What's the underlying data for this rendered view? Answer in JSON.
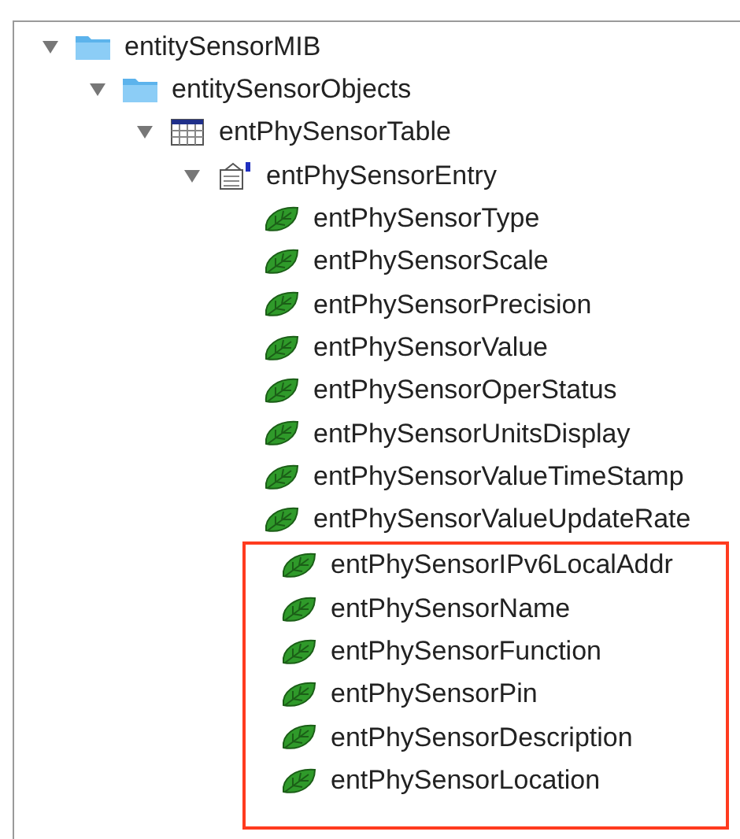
{
  "tree": [
    {
      "label": "entitySensorMIB",
      "kind": "folder",
      "expanded": true,
      "children": [
        {
          "label": "entitySensorObjects",
          "kind": "folder",
          "expanded": true,
          "children": [
            {
              "label": "entPhySensorTable",
              "kind": "table",
              "expanded": true,
              "children": [
                {
                  "label": "entPhySensorEntry",
                  "kind": "entry",
                  "expanded": true,
                  "children": [
                    {
                      "label": "entPhySensorType",
                      "kind": "leaf",
                      "highlighted": false
                    },
                    {
                      "label": "entPhySensorScale",
                      "kind": "leaf",
                      "highlighted": false
                    },
                    {
                      "label": "entPhySensorPrecision",
                      "kind": "leaf",
                      "highlighted": false
                    },
                    {
                      "label": "entPhySensorValue",
                      "kind": "leaf",
                      "highlighted": false
                    },
                    {
                      "label": "entPhySensorOperStatus",
                      "kind": "leaf",
                      "highlighted": false
                    },
                    {
                      "label": "entPhySensorUnitsDisplay",
                      "kind": "leaf",
                      "highlighted": false
                    },
                    {
                      "label": "entPhySensorValueTimeStamp",
                      "kind": "leaf",
                      "highlighted": false
                    },
                    {
                      "label": "entPhySensorValueUpdateRate",
                      "kind": "leaf",
                      "highlighted": false
                    },
                    {
                      "label": "entPhySensorIPv6LocalAddr",
                      "kind": "leaf",
                      "highlighted": true
                    },
                    {
                      "label": "entPhySensorName",
                      "kind": "leaf",
                      "highlighted": true
                    },
                    {
                      "label": "entPhySensorFunction",
                      "kind": "leaf",
                      "highlighted": true
                    },
                    {
                      "label": "entPhySensorPin",
                      "kind": "leaf",
                      "highlighted": true
                    },
                    {
                      "label": "entPhySensorDescription",
                      "kind": "leaf",
                      "highlighted": true
                    },
                    {
                      "label": "entPhySensorLocation",
                      "kind": "leaf",
                      "highlighted": true
                    }
                  ]
                }
              ]
            }
          ]
        }
      ]
    }
  ]
}
